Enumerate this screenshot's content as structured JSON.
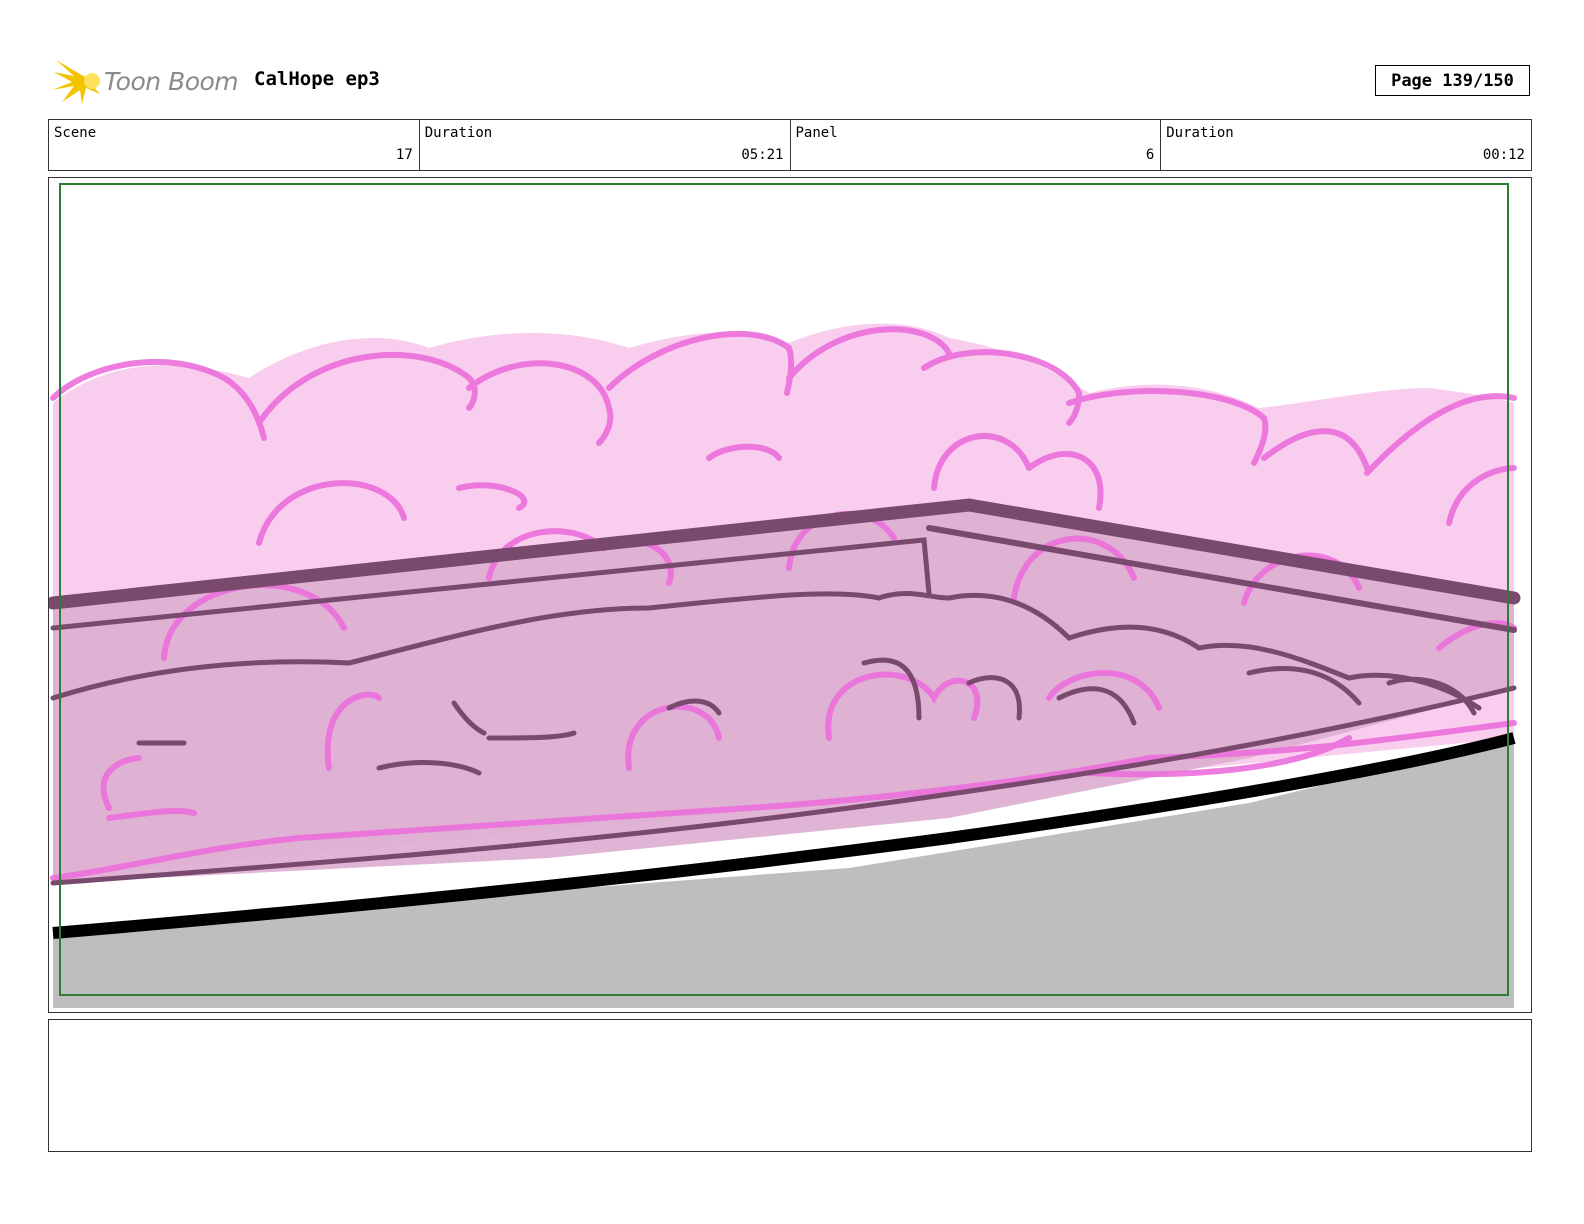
{
  "header": {
    "logo_text": "Toon Boom",
    "project_title": "CalHope ep3",
    "page_label": "Page 139/150"
  },
  "info": {
    "scene_label": "Scene",
    "scene_value": "17",
    "scene_duration_label": "Duration",
    "scene_duration_value": "05:21",
    "panel_label": "Panel",
    "panel_value": "6",
    "panel_duration_label": "Duration",
    "panel_duration_value": "00:12"
  },
  "colors": {
    "bush_fill": "#f9cdee",
    "bush_stroke": "#ec6fdc",
    "wall_fill": "#ddb0d2",
    "wall_stroke": "#7a4a6e",
    "ground": "#bebebe",
    "safe_frame": "#2e7d32"
  },
  "notes": {
    "text": ""
  }
}
